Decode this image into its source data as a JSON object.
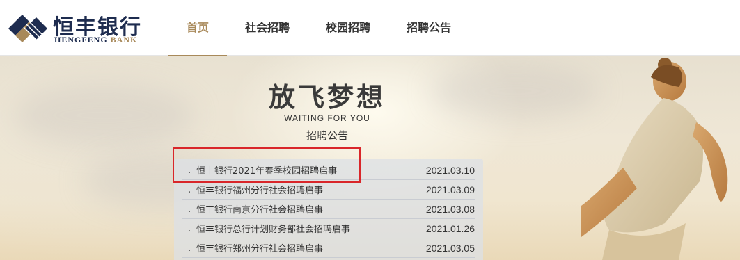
{
  "logo": {
    "cn": "恒丰银行",
    "en_main": "HENGFENG",
    "en_bank": "BANK"
  },
  "nav": {
    "items": [
      {
        "label": "首页",
        "active": true
      },
      {
        "label": "社会招聘",
        "active": false
      },
      {
        "label": "校园招聘",
        "active": false
      },
      {
        "label": "招聘公告",
        "active": false
      }
    ]
  },
  "hero": {
    "title": "放飞梦想",
    "subtitle_en": "WAITING  FOR  YOU",
    "subtitle_cn": "招聘公告"
  },
  "notices": [
    {
      "bullet": ".",
      "title": "恒丰银行2021年春季校园招聘启事",
      "date": "2021.03.10"
    },
    {
      "bullet": ".",
      "title": "恒丰银行福州分行社会招聘启事",
      "date": "2021.03.09"
    },
    {
      "bullet": ".",
      "title": "恒丰银行南京分行社会招聘启事",
      "date": "2021.03.08"
    },
    {
      "bullet": ".",
      "title": "恒丰银行总行计划财务部社会招聘启事",
      "date": "2021.01.26"
    },
    {
      "bullet": ".",
      "title": "恒丰银行郑州分行社会招聘启事",
      "date": "2021.03.05"
    }
  ],
  "colors": {
    "brand_navy": "#1e2c4f",
    "brand_gold": "#a8895a",
    "highlight_red": "#d9262a"
  }
}
